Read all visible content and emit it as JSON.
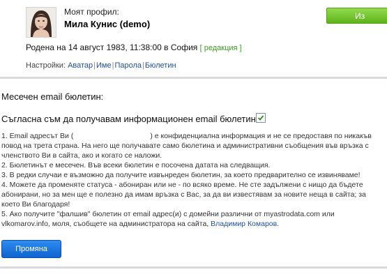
{
  "profile": {
    "label": "Моят профил:",
    "name": "Мила Кунис",
    "demo_open": "(",
    "demo": "demo",
    "demo_close": ")"
  },
  "header": {
    "exit_label": "Из"
  },
  "birth": {
    "text": "Родена на 14 август 1983, 11:38:00 в София",
    "edit_label": "[ редакция ]"
  },
  "settings": {
    "label": "Настройки:",
    "links": [
      "Аватар",
      "Име",
      "Парола",
      "Бюлетин"
    ],
    "separator": "|"
  },
  "newsletter": {
    "title": "Месечен email бюлетин:",
    "consent_label": "Съгласна съм да получавам информационен email бюлетин:",
    "consent_checked": true,
    "rules": {
      "r1_a": "1. Email адресът Ви (",
      "r1_b": ") е конфиденциална информация и не се предоставя по никакъв повод на трета страна. На него ще получавате само бюлетина и административни съобщения във връзка с членството Ви в сайта, ако и когато се наложи.",
      "r2": "2. Бюлетинът е месечен. Във всеки бюлетин е посочена датата на следващия.",
      "r3": "3. В редки случаи е възможно да получите извънреден бюлетин, за което предварително се извиняваме!",
      "r4": "4. Можете да променяте статуса - абониран или не - по всяко време. Не сте задължени с нищо да бъдете абонирани, но за мен ще е полезно да имам връзка с Вас, за да ви известявам за новите неща в сайта; за което Ви благодаря!",
      "r5_a": "5. Ако получите \"фалшив\" бюлетин от email адрес(и) с домейни различни от myastrodata.com или vlkomarov.info, моля, съобщете на администратора на сайта, ",
      "r5_author": "Владимир Комаров",
      "r5_end": "."
    },
    "submit_label": "Промяна"
  }
}
